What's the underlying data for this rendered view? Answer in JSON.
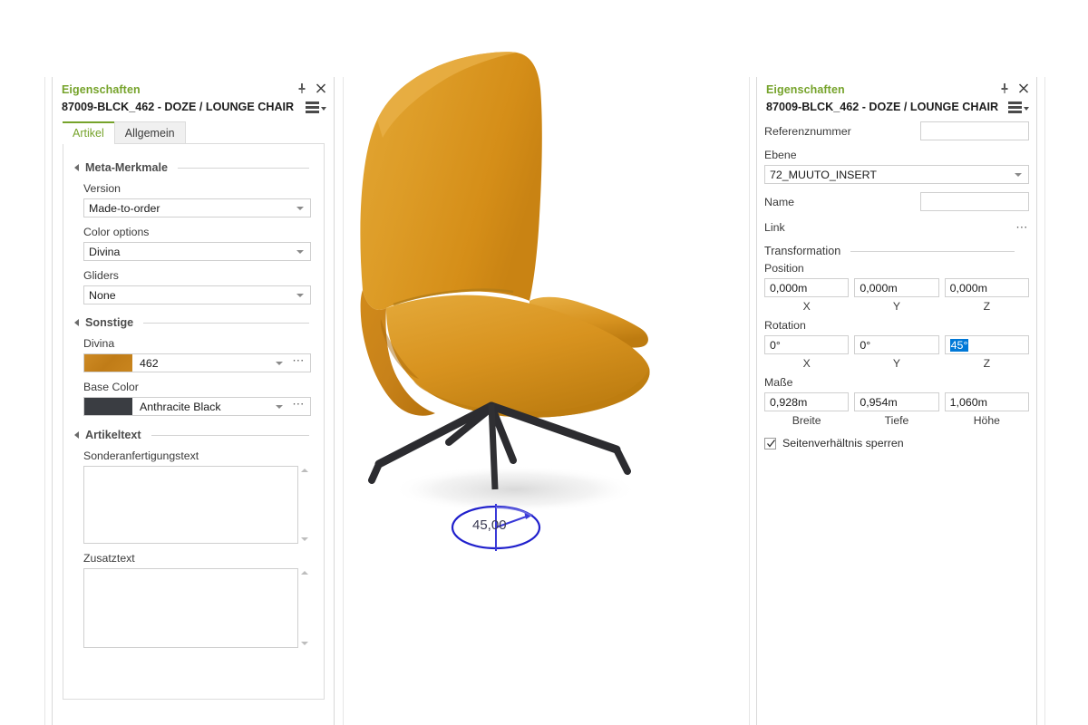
{
  "app": {
    "accent_green": "#76a32b",
    "selection_blue": "#0078d7",
    "chair_color": "#d9921f",
    "swatch_divina": "#c8821f",
    "swatch_base": "#3a3d42"
  },
  "left_panel": {
    "title": "Eigenschaften",
    "subtitle": "87009-BLCK_462 - DOZE / LOUNGE CHAIR",
    "pin_icon": "pin-icon",
    "close_icon": "close-icon",
    "menu_icon": "hamburger-menu-icon",
    "tabs": [
      {
        "label": "Artikel",
        "active": true
      },
      {
        "label": "Allgemein",
        "active": false
      }
    ],
    "sections": [
      {
        "title": "Meta-Merkmale",
        "fields": [
          {
            "label": "Version",
            "value": "Made-to-order",
            "type": "combo"
          },
          {
            "label": "Color options",
            "value": "Divina",
            "type": "combo"
          },
          {
            "label": "Gliders",
            "value": "None",
            "type": "combo"
          }
        ]
      },
      {
        "title": "Sonstige",
        "fields": [
          {
            "label": "Divina",
            "value": "462",
            "type": "swatch-combo",
            "swatch": "#c8821f"
          },
          {
            "label": "Base Color",
            "value": "Anthracite Black",
            "type": "swatch-combo",
            "swatch": "#3a3d42"
          }
        ]
      },
      {
        "title": "Artikeltext",
        "fields": [
          {
            "label": "Sonderanfertigungstext",
            "value": "",
            "type": "textarea"
          },
          {
            "label": "Zusatztext",
            "value": "",
            "type": "textarea"
          }
        ]
      }
    ]
  },
  "right_panel": {
    "title": "Eigenschaften",
    "subtitle": "87009-BLCK_462 - DOZE / LOUNGE CHAIR",
    "pin_icon": "pin-icon",
    "close_icon": "close-icon",
    "menu_icon": "hamburger-menu-icon",
    "reference_label": "Referenznummer",
    "reference_value": "",
    "layer_label": "Ebene",
    "layer_value": "72_MUUTO_INSERT",
    "name_label": "Name",
    "name_value": "",
    "link_label": "Link",
    "link_dots": "…",
    "transformation_title": "Transformation",
    "position_label": "Position",
    "position_values": [
      "0,000m",
      "0,000m",
      "0,000m"
    ],
    "position_axes": [
      "X",
      "Y",
      "Z"
    ],
    "rotation_label": "Rotation",
    "rotation_values": [
      "0°",
      "0°",
      "45°"
    ],
    "rotation_axes": [
      "X",
      "Y",
      "Z"
    ],
    "rotation_selected_index": 2,
    "dimensions_label": "Maße",
    "dimensions_values": [
      "0,928m",
      "0,954m",
      "1,060m"
    ],
    "dimensions_captions": [
      "Breite",
      "Tiefe",
      "Höhe"
    ],
    "lock_aspect_label": "Seitenverhältnis sperren",
    "lock_aspect_checked": true
  },
  "viewport": {
    "model_name": "DOZE / LOUNGE CHAIR",
    "rotation_readout": "45,00",
    "rotation_gizmo": "rotation-ellipse-gizmo"
  }
}
